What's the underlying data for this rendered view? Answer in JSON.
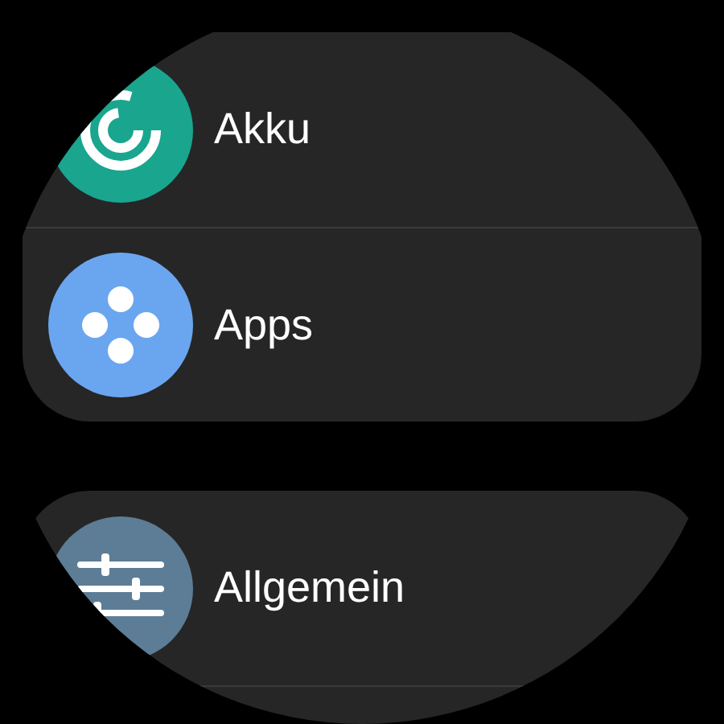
{
  "groups": [
    {
      "items": [
        {
          "label": "Akku",
          "kind": "battery",
          "color": "#1aa58f"
        },
        {
          "label": "Apps",
          "kind": "apps",
          "color": "#6aa6f0"
        }
      ]
    },
    {
      "items": [
        {
          "label": "Allgemein",
          "kind": "general",
          "color": "#5d7d96"
        }
      ]
    }
  ]
}
